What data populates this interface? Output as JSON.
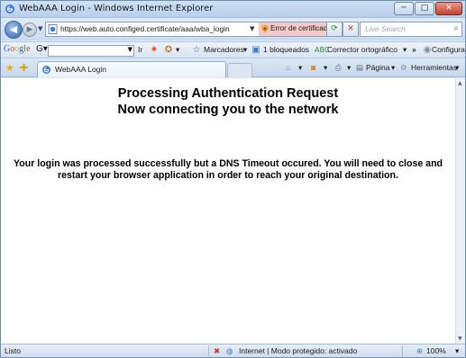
{
  "window": {
    "title": "WebAAA Login - Windows Internet Explorer",
    "minimize": "─",
    "maximize": "□",
    "close": "✕"
  },
  "address_bar": {
    "url": "https://web.auto.configed.certificate/aaa/wba_login",
    "certificate_error": "Error de certificado",
    "search_placeholder": "Live Search"
  },
  "google_toolbar": {
    "logo": "Google",
    "go_label": "Ir",
    "bookmarks_label": "Marcadores",
    "blocked_label": "1 bloqueados",
    "spellcheck_label": "Corrector ortográfico",
    "more": "»",
    "settings_label": "Configuración"
  },
  "tabs": {
    "active_label": "WebAAA Login",
    "page_label": "Página",
    "tools_label": "Herramientas",
    "more": "»"
  },
  "content": {
    "heading_line1": "Processing Authentication Request",
    "heading_line2": "Now connecting you to the network",
    "message": "Your login was processed successfully but a DNS Timeout occured. You will need to close and restart your browser application in order to reach your original destination."
  },
  "status_bar": {
    "status": "Listo",
    "zone": "Internet | Modo protegido: activado",
    "zoom": "100%"
  },
  "colors": {
    "chrome_blue": "#dbe8f5",
    "cert_error_bg": "#f3c9c9",
    "close_red": "#c3432b"
  },
  "icons": [
    "ie-icon",
    "back-icon",
    "forward-icon",
    "refresh-icon",
    "stop-icon",
    "search-icon",
    "star-icon",
    "add-favorite-icon",
    "home-icon",
    "feeds-icon",
    "print-icon",
    "page-icon",
    "tools-icon",
    "globe-icon",
    "zoom-icon"
  ]
}
